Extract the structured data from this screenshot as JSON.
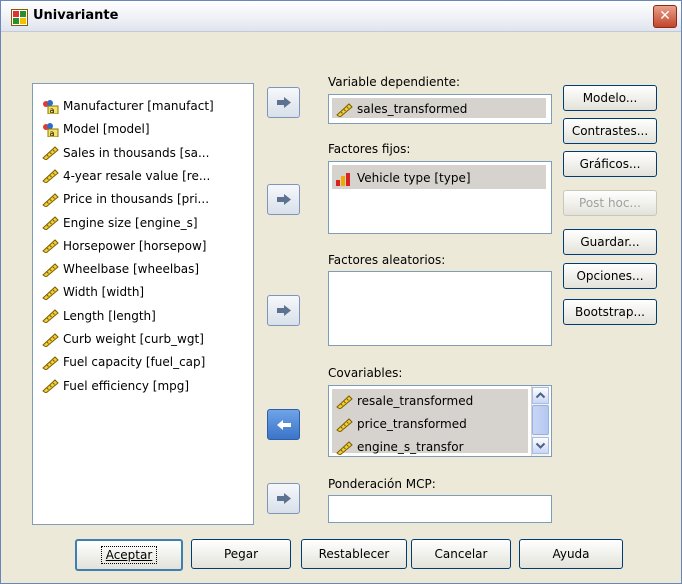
{
  "window": {
    "title": "Univariante",
    "close_label": "✕"
  },
  "variables": [
    {
      "label": "Manufacturer [manufact]",
      "icon": "nominal-string-icon"
    },
    {
      "label": "Model [model]",
      "icon": "nominal-string-icon"
    },
    {
      "label": "Sales in thousands [sa...",
      "icon": "scale-ruler-icon"
    },
    {
      "label": "4-year resale value [re...",
      "icon": "scale-ruler-icon"
    },
    {
      "label": "Price in thousands [pri...",
      "icon": "scale-ruler-icon"
    },
    {
      "label": "Engine size [engine_s]",
      "icon": "scale-ruler-icon"
    },
    {
      "label": "Horsepower [horsepow]",
      "icon": "scale-ruler-icon"
    },
    {
      "label": "Wheelbase [wheelbas]",
      "icon": "scale-ruler-icon"
    },
    {
      "label": "Width [width]",
      "icon": "scale-ruler-icon"
    },
    {
      "label": "Length [length]",
      "icon": "scale-ruler-icon"
    },
    {
      "label": "Curb weight [curb_wgt]",
      "icon": "scale-ruler-icon"
    },
    {
      "label": "Fuel capacity [fuel_cap]",
      "icon": "scale-ruler-icon"
    },
    {
      "label": "Fuel efficiency [mpg]",
      "icon": "scale-ruler-icon"
    }
  ],
  "dependent": {
    "label": "Variable dependiente:",
    "value": "sales_transformed"
  },
  "fixed_factors": {
    "label": "Factores fijos:",
    "items": [
      "Vehicle type [type]"
    ]
  },
  "random_factors": {
    "label": "Factores aleatorios:",
    "items": []
  },
  "covariates": {
    "label": "Covariables:",
    "items": [
      "resale_transformed",
      "price_transformed",
      "engine_s_transfor"
    ]
  },
  "wls_weight": {
    "label": "Ponderación MCP:",
    "value": ""
  },
  "side_buttons": [
    {
      "label": "Modelo...",
      "enabled": true
    },
    {
      "label": "Contrastes...",
      "enabled": true
    },
    {
      "label": "Gráficos...",
      "enabled": true
    },
    {
      "label": "Post hoc...",
      "enabled": false
    },
    {
      "label": "Guardar...",
      "enabled": true
    },
    {
      "label": "Opciones...",
      "enabled": true
    },
    {
      "label": "Bootstrap...",
      "enabled": true
    }
  ],
  "bottom_buttons": {
    "ok": "Aceptar",
    "paste": "Pegar",
    "reset": "Restablecer",
    "cancel": "Cancelar",
    "help": "Ayuda"
  },
  "colors": {
    "titlebar_close": "#c2452b",
    "listbox_border": "#7f9db9",
    "active_arrow": "#3b74c9"
  }
}
